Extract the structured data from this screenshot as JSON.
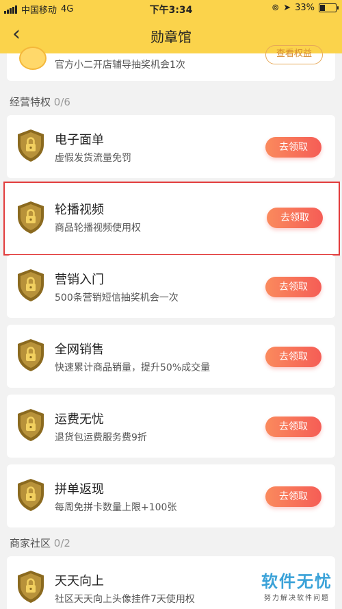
{
  "status": {
    "carrier": "中国移动",
    "network": "4G",
    "time": "下午3:34",
    "battery": "33%",
    "battery_level": 0.33
  },
  "nav": {
    "title": "勋章馆",
    "back_glyph": "‹"
  },
  "top_partial": {
    "desc": "官方小二开店辅导抽奖机会1次",
    "button": "查看权益"
  },
  "sections": [
    {
      "title": "经营特权",
      "count": "0/6"
    },
    {
      "title": "商家社区",
      "count": "0/2"
    }
  ],
  "cards": [
    {
      "name": "电子面单",
      "desc": "虚假发货流量免罚",
      "button": "去领取"
    },
    {
      "name": "轮播视频",
      "desc": "商品轮播视频使用权",
      "button": "去领取"
    },
    {
      "name": "营销入门",
      "desc": "500条营销短信抽奖机会一次",
      "button": "去领取"
    },
    {
      "name": "全网销售",
      "desc": "快速累计商品销量，提升50%成交量",
      "button": "去领取"
    },
    {
      "name": "运费无忧",
      "desc": "退货包运费服务费9折",
      "button": "去领取"
    },
    {
      "name": "拼单返现",
      "desc": "每周免拼卡数量上限+100张",
      "button": "去领取"
    },
    {
      "name": "天天向上",
      "desc": "社区天天向上头像挂件7天使用权",
      "button": ""
    }
  ],
  "watermark": {
    "main": "软件无忧",
    "sub": "努力解决软件问题"
  },
  "colors": {
    "accent": "#fbd34b",
    "button": "#f76a58",
    "highlight": "#e23c3c",
    "shield": "#8b6a1f"
  }
}
